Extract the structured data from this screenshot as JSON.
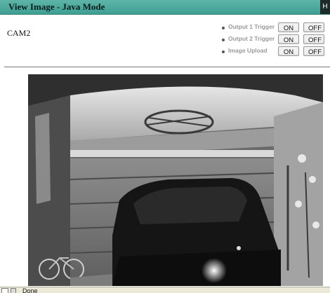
{
  "header": {
    "title": "View Image - Java Mode",
    "corner_label": "H"
  },
  "camera": {
    "name": "CAM2"
  },
  "controls": [
    {
      "label": "Output 1 Trigger",
      "on_label": "ON",
      "off_label": "OFF"
    },
    {
      "label": "Output 2 Trigger",
      "on_label": "ON",
      "off_label": "OFF"
    },
    {
      "label": "Image Upload",
      "on_label": "ON",
      "off_label": "OFF"
    }
  ],
  "status_bar": {
    "text": "Done"
  },
  "colors": {
    "header_bar": "#4aa99c",
    "divider": "#777777"
  }
}
